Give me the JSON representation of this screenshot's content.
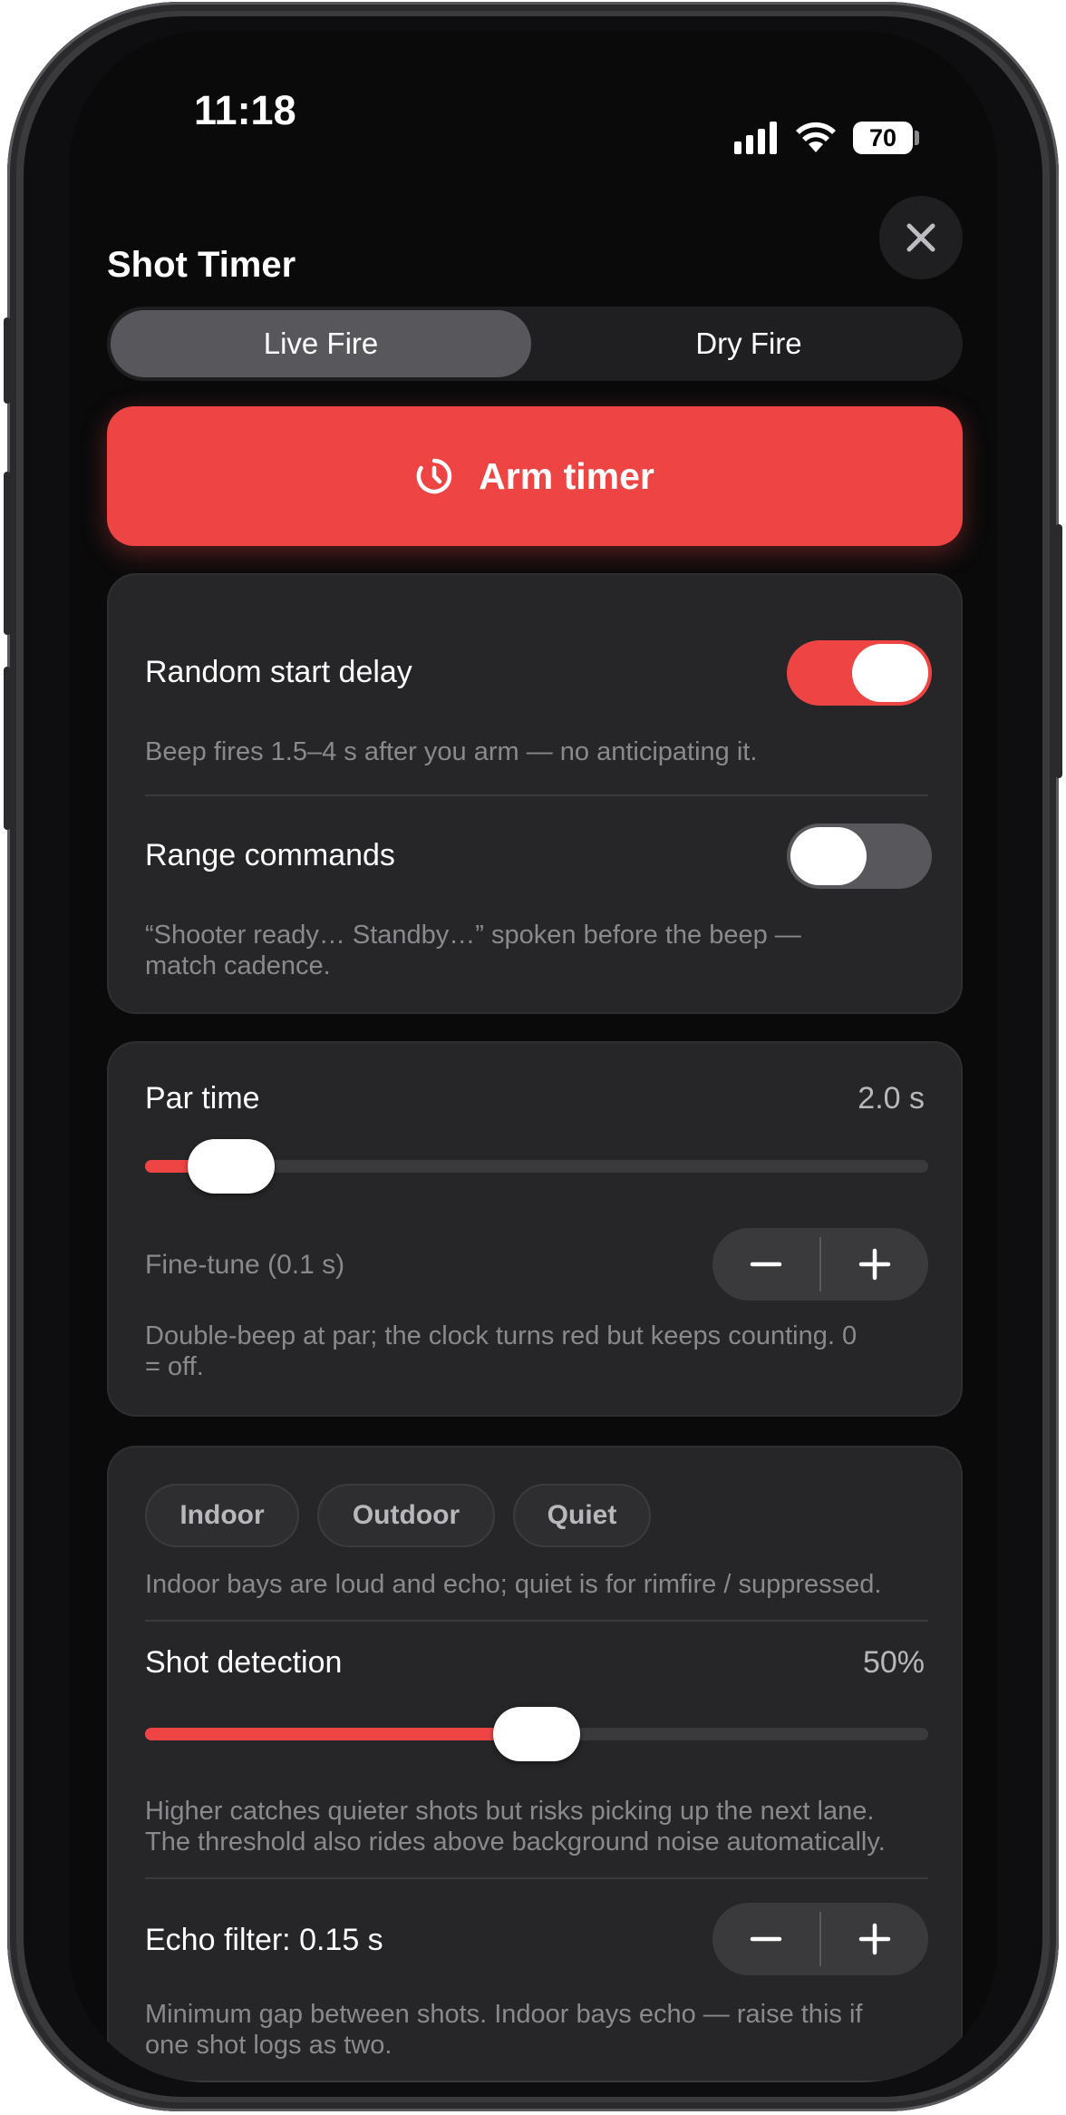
{
  "status_bar": {
    "time": "11:18",
    "battery": "70"
  },
  "header": {
    "title": "Shot Timer"
  },
  "mode_tabs": {
    "live_fire": "Live Fire",
    "dry_fire": "Dry Fire",
    "selected": "Live Fire"
  },
  "arm_button": {
    "label": "Arm timer"
  },
  "start_settings": {
    "random_delay": {
      "label": "Random start delay",
      "enabled": true,
      "description": "Beep fires 1.5–4 s after you arm — no anticipating it."
    },
    "range_commands": {
      "label": "Range commands",
      "enabled": false,
      "description_line1": "“Shooter ready… Standby…” spoken before the beep —",
      "description_line2": "match cadence."
    }
  },
  "par_time": {
    "label": "Par time",
    "value_text": "2.0 s",
    "slider_fraction": 0.11,
    "fine_tune_label": "Fine-tune (0.1 s)",
    "description_line1": "Double-beep at par; the clock turns red but keeps counting. 0",
    "description_line2": "= off."
  },
  "environment": {
    "chips": [
      "Indoor",
      "Outdoor",
      "Quiet"
    ],
    "description": "Indoor bays are loud and echo; quiet is for rimfire / suppressed."
  },
  "shot_detection": {
    "label": "Shot detection",
    "value_text": "50%",
    "slider_fraction": 0.5,
    "description_line1": "Higher catches quieter shots but risks picking up the next lane.",
    "description_line2": "The threshold also rides above background noise automatically."
  },
  "echo_filter": {
    "label": "Echo filter: 0.15 s",
    "description_line1": "Minimum gap between shots. Indoor bays echo — raise this if",
    "description_line2": "one shot logs as two."
  },
  "colors": {
    "accent": "#ef4444",
    "background": "#0a0a0b",
    "card": "#262628"
  }
}
